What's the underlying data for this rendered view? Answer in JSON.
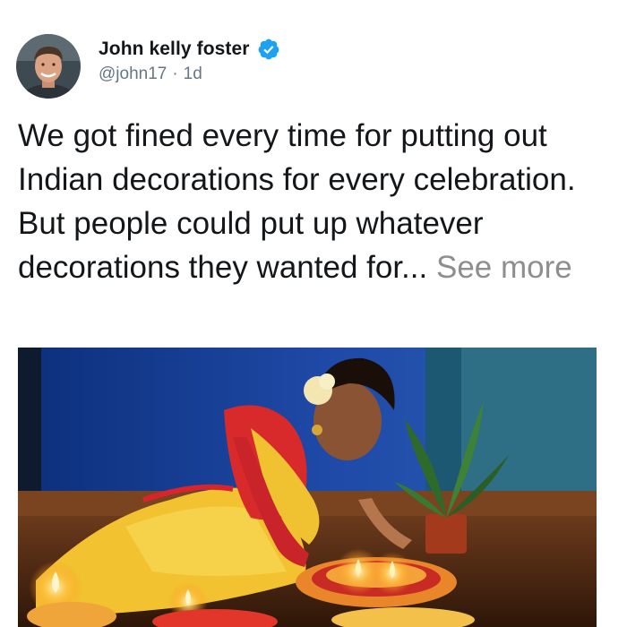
{
  "author": {
    "name": "John kelly foster",
    "handle": "@john17",
    "separator": "·",
    "time": "1d",
    "verified": true,
    "avatar_icon": "profile-photo"
  },
  "tweet": {
    "text": "We got fined every time for putting out Indian decorations for every celebration. But people could put up whatever decorations they wanted for...",
    "see_more_label": "See more"
  },
  "media": {
    "type": "photo",
    "subject": "woman lighting diyas among marigold flower rangoli"
  },
  "colors": {
    "verified_blue": "#1da1f2",
    "text_primary": "#14171a",
    "text_secondary": "#657786",
    "see_more": "#8e8e8e"
  }
}
